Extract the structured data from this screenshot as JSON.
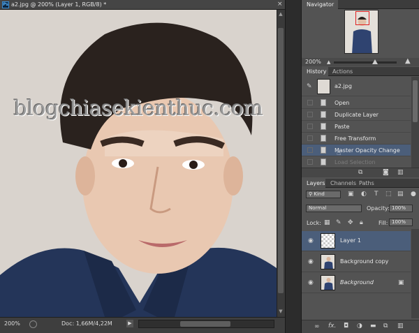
{
  "document": {
    "app_badge": "Ps",
    "title": "a2.jpg @ 200% (Layer 1, RGB/8) *",
    "close": "×",
    "zoom": "200%",
    "doc_info": "Doc: 1,66M/4,22M",
    "scroll_up": "▲",
    "scroll_down": "▼",
    "info_arrow": "▶",
    "watermark": "blogchiasekienthuc.com"
  },
  "navigator": {
    "tab": "Navigator",
    "zoom": "200%",
    "zoom_out_icon": "mountain-small-icon",
    "zoom_in_icon": "mountain-large-icon"
  },
  "history": {
    "tabs": [
      "History",
      "Actions"
    ],
    "snapshot": "a2.jpg",
    "items": [
      {
        "label": "Open",
        "state": "normal"
      },
      {
        "label": "Duplicate Layer",
        "state": "normal"
      },
      {
        "label": "Paste",
        "state": "normal"
      },
      {
        "label": "Free Transform",
        "state": "normal"
      },
      {
        "label": "Master Opacity Change",
        "state": "selected"
      },
      {
        "label": "Load Selection",
        "state": "dimmed"
      }
    ],
    "selection_color": "#4b5e7a"
  },
  "layers": {
    "tabs": [
      "Layers",
      "Channels",
      "Paths"
    ],
    "filter_kind": "Kind",
    "blend_mode": "Normal",
    "opacity_label": "Opacity:",
    "opacity_value": "100%",
    "lock_label": "Lock:",
    "fill_label": "Fill:",
    "fill_value": "100%",
    "items": [
      {
        "name": "Layer 1",
        "selected": true,
        "italic": false
      },
      {
        "name": "Background copy",
        "selected": false,
        "italic": false
      },
      {
        "name": "Background",
        "selected": false,
        "italic": true
      }
    ],
    "footer_icons": [
      "link-icon",
      "fx-icon",
      "mask-icon",
      "adjustment-icon",
      "folder-icon",
      "new-layer-icon",
      "trash-icon"
    ]
  }
}
